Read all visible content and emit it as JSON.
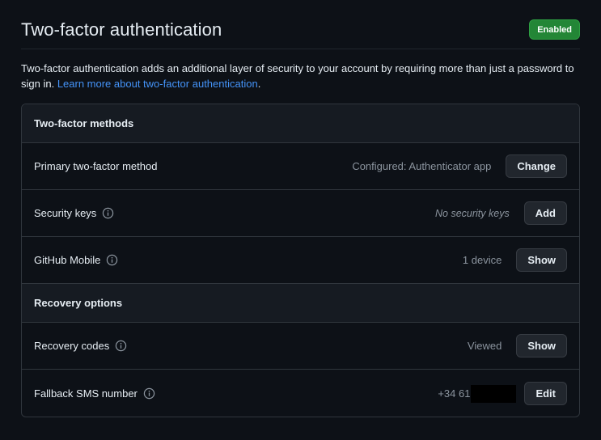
{
  "header": {
    "title": "Two-factor authentication",
    "status": "Enabled"
  },
  "description": {
    "text": "Two-factor authentication adds an additional layer of security to your account by requiring more than just a password to sign in. ",
    "link": "Learn more about two-factor authentication",
    "suffix": "."
  },
  "methods": {
    "heading": "Two-factor methods",
    "primary": {
      "label": "Primary two-factor method",
      "value": "Configured: Authenticator app",
      "button": "Change"
    },
    "security_keys": {
      "label": "Security keys",
      "value": "No security keys",
      "button": "Add"
    },
    "github_mobile": {
      "label": "GitHub Mobile",
      "value": "1 device",
      "button": "Show"
    }
  },
  "recovery": {
    "heading": "Recovery options",
    "codes": {
      "label": "Recovery codes",
      "value": "Viewed",
      "button": "Show"
    },
    "sms": {
      "label": "Fallback SMS number",
      "value": "+34 61",
      "button": "Edit"
    }
  },
  "colors": {
    "badge": "#238636",
    "link": "#4493f8",
    "background": "#0d1117"
  },
  "icons": {
    "info": "info-circle-icon"
  }
}
